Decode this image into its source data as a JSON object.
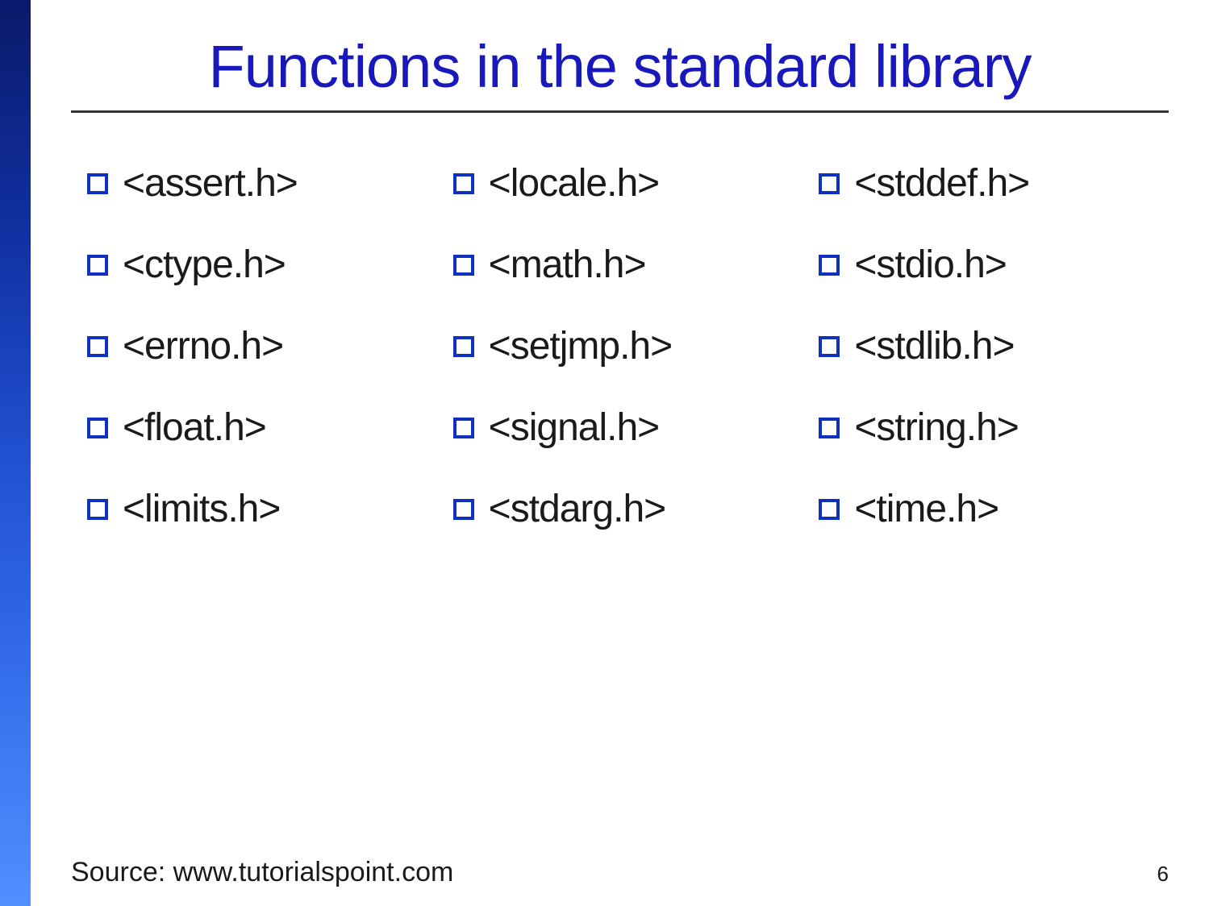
{
  "title": "Functions in the standard library",
  "columns": [
    {
      "items": [
        "<assert.h>",
        "<ctype.h>",
        "<errno.h>",
        "<float.h>",
        "<limits.h>"
      ]
    },
    {
      "items": [
        "<locale.h>",
        "<math.h>",
        "<setjmp.h>",
        "<signal.h>",
        "<stdarg.h>"
      ]
    },
    {
      "items": [
        "<stddef.h>",
        "<stdio.h>",
        "<stdlib.h>",
        "<string.h>",
        "<time.h>"
      ]
    }
  ],
  "source": "Source: www.tutorialspoint.com",
  "page_number": "6"
}
